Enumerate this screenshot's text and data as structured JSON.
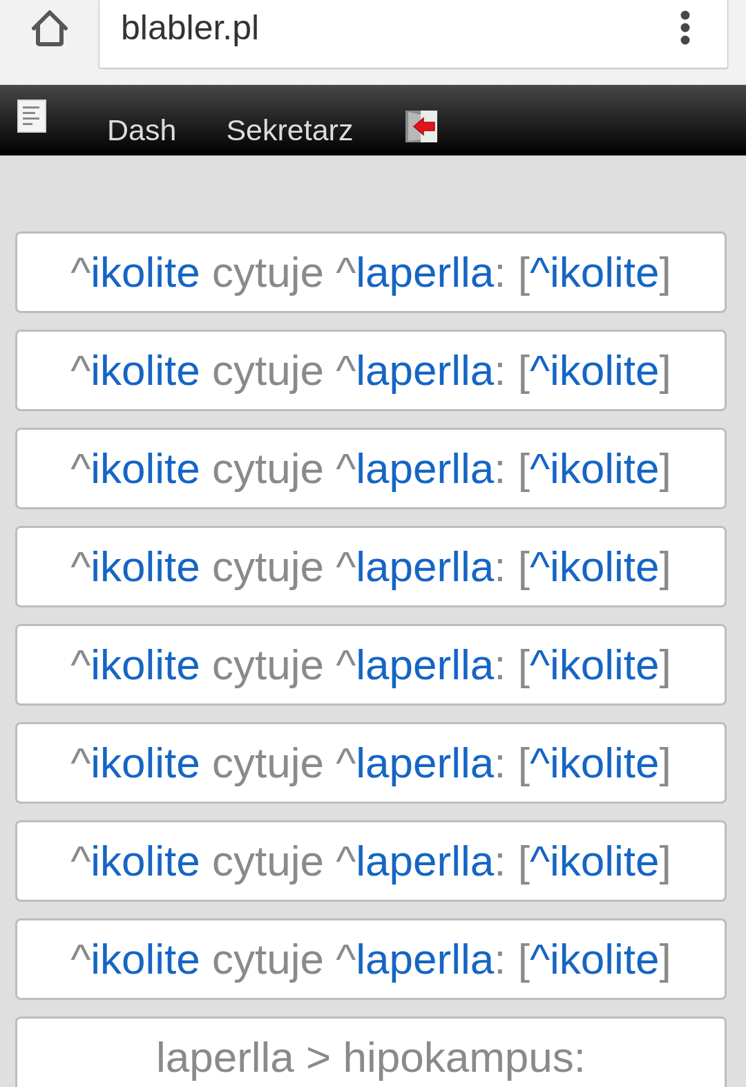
{
  "browser": {
    "url": "blabler.pl"
  },
  "nav": {
    "links": [
      "Dash",
      "Sekretarz"
    ]
  },
  "feed": [
    {
      "segments": [
        {
          "kind": "text",
          "text": "^"
        },
        {
          "kind": "link",
          "text": "ikolite"
        },
        {
          "kind": "text",
          "text": " cytuje ^"
        },
        {
          "kind": "link",
          "text": "laperlla"
        },
        {
          "kind": "text",
          "text": ": ["
        },
        {
          "kind": "link",
          "text": "^ikolite"
        },
        {
          "kind": "text",
          "text": "]"
        }
      ]
    },
    {
      "segments": [
        {
          "kind": "text",
          "text": "^"
        },
        {
          "kind": "link",
          "text": "ikolite"
        },
        {
          "kind": "text",
          "text": " cytuje ^"
        },
        {
          "kind": "link",
          "text": "laperlla"
        },
        {
          "kind": "text",
          "text": ": ["
        },
        {
          "kind": "link",
          "text": "^ikolite"
        },
        {
          "kind": "text",
          "text": "]"
        }
      ]
    },
    {
      "segments": [
        {
          "kind": "text",
          "text": "^"
        },
        {
          "kind": "link",
          "text": "ikolite"
        },
        {
          "kind": "text",
          "text": " cytuje ^"
        },
        {
          "kind": "link",
          "text": "laperlla"
        },
        {
          "kind": "text",
          "text": ": ["
        },
        {
          "kind": "link",
          "text": "^ikolite"
        },
        {
          "kind": "text",
          "text": "]"
        }
      ]
    },
    {
      "segments": [
        {
          "kind": "text",
          "text": "^"
        },
        {
          "kind": "link",
          "text": "ikolite"
        },
        {
          "kind": "text",
          "text": " cytuje ^"
        },
        {
          "kind": "link",
          "text": "laperlla"
        },
        {
          "kind": "text",
          "text": ": ["
        },
        {
          "kind": "link",
          "text": "^ikolite"
        },
        {
          "kind": "text",
          "text": "]"
        }
      ]
    },
    {
      "segments": [
        {
          "kind": "text",
          "text": "^"
        },
        {
          "kind": "link",
          "text": "ikolite"
        },
        {
          "kind": "text",
          "text": " cytuje ^"
        },
        {
          "kind": "link",
          "text": "laperlla"
        },
        {
          "kind": "text",
          "text": ": ["
        },
        {
          "kind": "link",
          "text": "^ikolite"
        },
        {
          "kind": "text",
          "text": "]"
        }
      ]
    },
    {
      "segments": [
        {
          "kind": "text",
          "text": "^"
        },
        {
          "kind": "link",
          "text": "ikolite"
        },
        {
          "kind": "text",
          "text": " cytuje ^"
        },
        {
          "kind": "link",
          "text": "laperlla"
        },
        {
          "kind": "text",
          "text": ": ["
        },
        {
          "kind": "link",
          "text": "^ikolite"
        },
        {
          "kind": "text",
          "text": "]"
        }
      ]
    },
    {
      "segments": [
        {
          "kind": "text",
          "text": "^"
        },
        {
          "kind": "link",
          "text": "ikolite"
        },
        {
          "kind": "text",
          "text": " cytuje ^"
        },
        {
          "kind": "link",
          "text": "laperlla"
        },
        {
          "kind": "text",
          "text": ": ["
        },
        {
          "kind": "link",
          "text": "^ikolite"
        },
        {
          "kind": "text",
          "text": "]"
        }
      ]
    },
    {
      "segments": [
        {
          "kind": "text",
          "text": "^"
        },
        {
          "kind": "link",
          "text": "ikolite"
        },
        {
          "kind": "text",
          "text": " cytuje ^"
        },
        {
          "kind": "link",
          "text": "laperlla"
        },
        {
          "kind": "text",
          "text": ": ["
        },
        {
          "kind": "link",
          "text": "^ikolite"
        },
        {
          "kind": "text",
          "text": "]"
        }
      ]
    },
    {
      "segments": [
        {
          "kind": "text",
          "text": "laperlla > hipokampus:"
        }
      ]
    }
  ]
}
